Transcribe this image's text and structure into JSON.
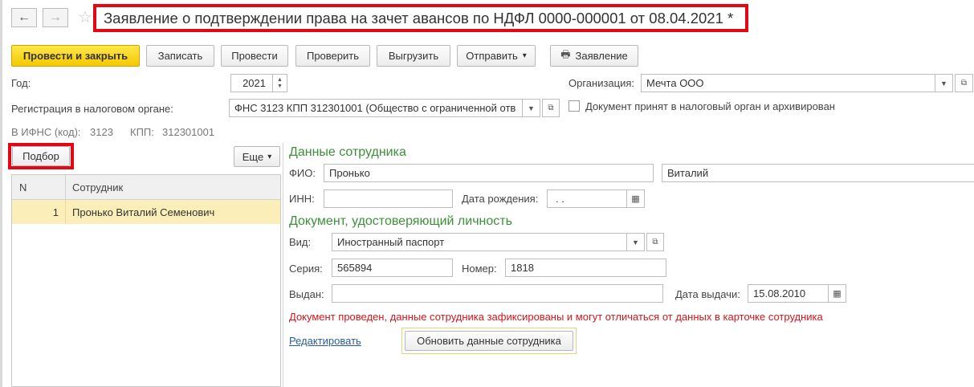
{
  "window": {
    "title": "Заявление о подтверждении права на зачет авансов по НДФЛ 0000-000001 от 08.04.2021 *"
  },
  "nav": {
    "back_icon": "←",
    "forward_icon": "→",
    "favorite_icon": "☆"
  },
  "toolbar": {
    "post_close": "Провести и закрыть",
    "save": "Записать",
    "post": "Провести",
    "check": "Проверить",
    "export": "Выгрузить",
    "send": "Отправить",
    "send_arrow": "▾",
    "statement": "Заявление",
    "print_icon": "🖶"
  },
  "header": {
    "year_label": "Год:",
    "year_value": "2021",
    "org_label": "Организация:",
    "org_value": "Мечта ООО",
    "tax_reg_label": "Регистрация в налоговом органе:",
    "tax_reg_value": "ФНС 3123 КПП 312301001 (Общество с ограниченной отв",
    "accepted_label": "Документ принят в налоговый орган и архивирован",
    "ifns_label": "В ИФНС (код):",
    "ifns_value": "3123",
    "kpp_label": "КПП:",
    "kpp_value": "312301001"
  },
  "list": {
    "pick_button": "Подбор",
    "more_button": "Еще",
    "more_arrow": "▾",
    "columns": [
      "N",
      "Сотрудник"
    ],
    "rows": [
      {
        "n": "1",
        "employee": "Пронько Виталий Семенович"
      }
    ]
  },
  "employee": {
    "section_title": "Данные сотрудника",
    "fio_label": "ФИО:",
    "last_name": "Пронько",
    "first_name": "Виталий",
    "inn_label": "ИНН:",
    "inn_value": "",
    "birth_label": "Дата рождения:",
    "birth_value": " .  .",
    "doc_section_title": "Документ, удостоверяющий личность",
    "kind_label": "Вид:",
    "kind_value": "Иностранный паспорт",
    "series_label": "Серия:",
    "series_value": "565894",
    "number_label": "Номер:",
    "number_value": "1818",
    "issued_label": "Выдан:",
    "issued_value": "",
    "issue_date_label": "Дата выдачи:",
    "issue_date_value": "15.08.2010",
    "warning": "Документ проведен, данные сотрудника зафиксированы и могут отличаться от данных в карточке сотрудника",
    "edit_link": "Редактировать",
    "update_button": "Обновить данные сотрудника"
  },
  "colors": {
    "primary_button": "#f5c800",
    "section_title": "#3e8f3a",
    "warning_text": "#d4151b",
    "highlight_outline": "#e30613",
    "selected_row": "#fbeeb8"
  }
}
